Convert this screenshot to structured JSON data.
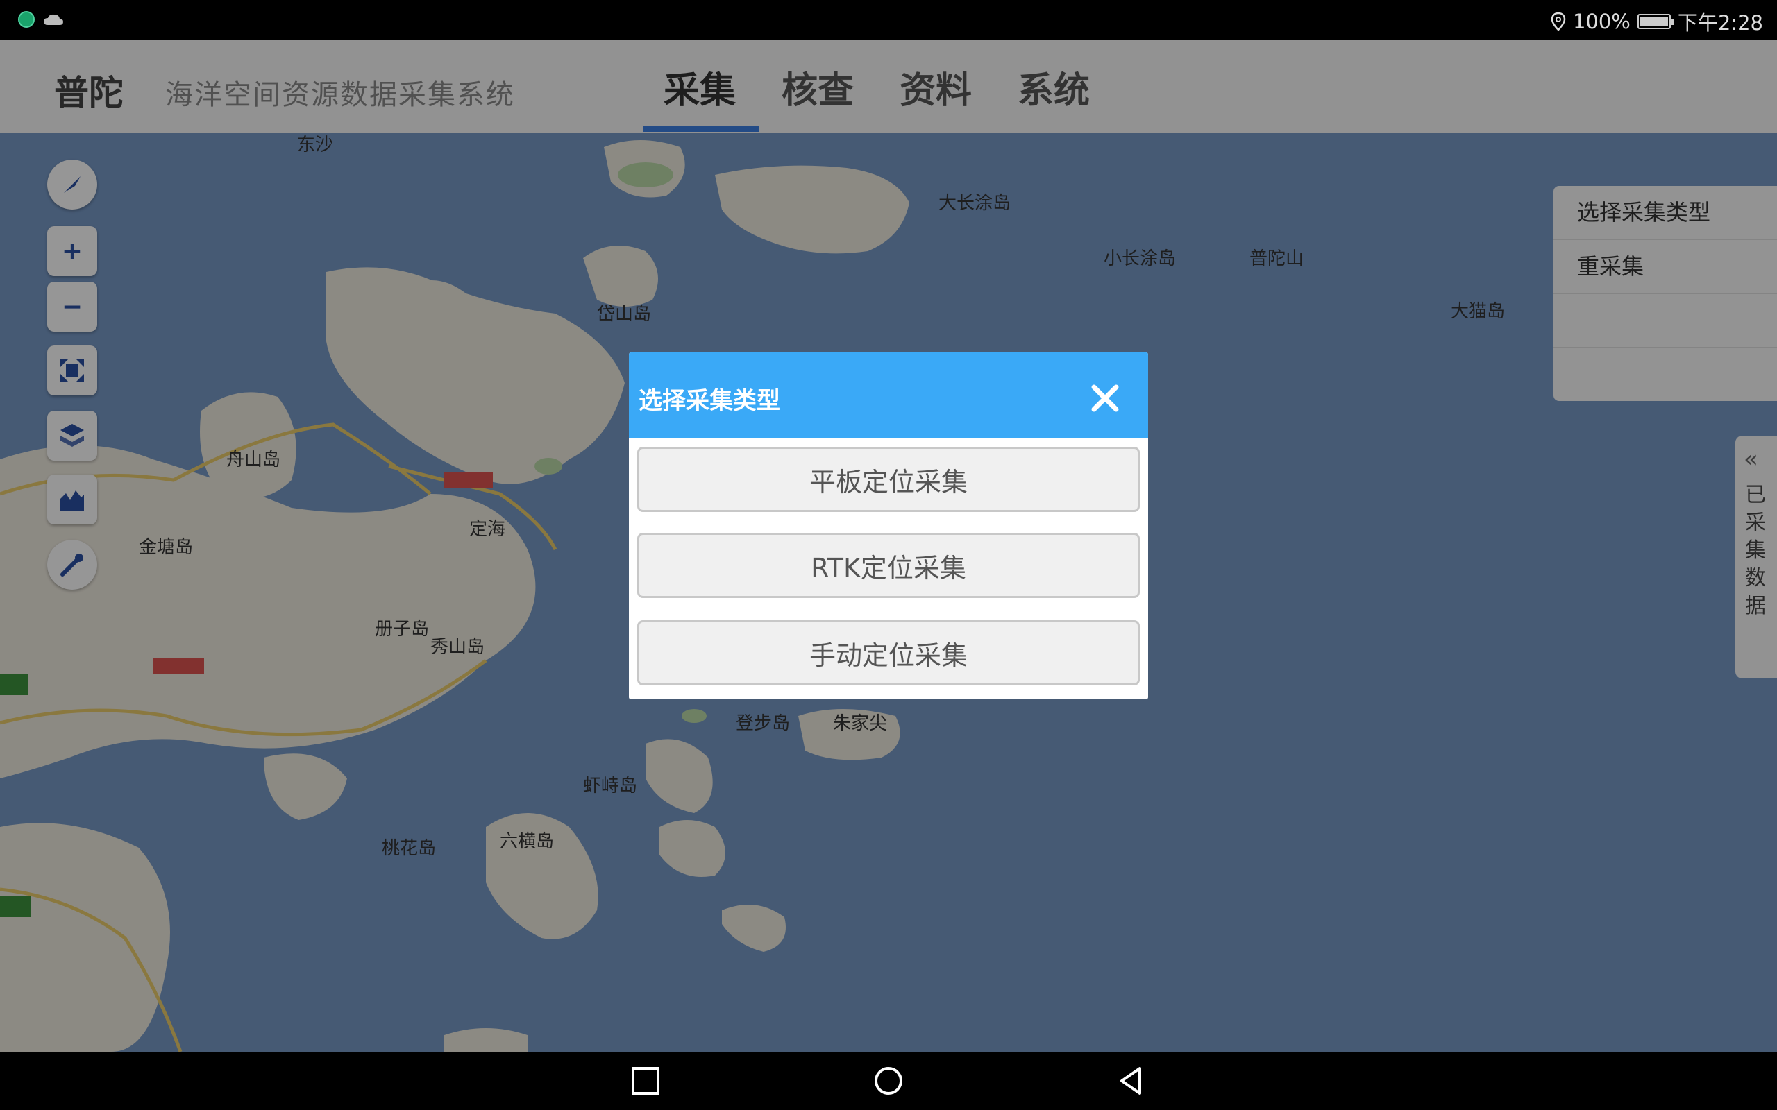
{
  "status_bar": {
    "battery_percent": "100%",
    "time": "下午2:28",
    "icons": [
      "app-icon",
      "cloud-icon",
      "location-icon",
      "battery-charging-icon"
    ],
    "battery_level": 1.0
  },
  "app": {
    "brand": "普陀",
    "system_name": "海洋空间资源数据采集系统",
    "nav_tabs": [
      {
        "label": "采集",
        "active": true
      },
      {
        "label": "核查",
        "active": false
      },
      {
        "label": "资料",
        "active": false
      },
      {
        "label": "系统",
        "active": false
      }
    ],
    "left_tools": [
      "compass-icon",
      "zoom-in-icon",
      "zoom-out-icon",
      "fullscreen-icon",
      "layers-icon",
      "chart-icon",
      "wrench-icon"
    ],
    "right_panel": {
      "items": [
        "选择采集类型",
        "重采集",
        "",
        ""
      ]
    },
    "right_tab": {
      "chevron": "«",
      "label": "已采集数据"
    },
    "map_labels": [
      "东沙",
      "大长涂岛",
      "小长涂岛",
      "岱山岛",
      "舟山岛",
      "定海",
      "六横岛",
      "虾峙岛",
      "桃花岛",
      "登步岛",
      "朱家尖",
      "普陀山",
      "大猫岛",
      "册子岛",
      "金塘岛",
      "秀山岛"
    ]
  },
  "dialog": {
    "title": "选择采集类型",
    "close_icon": "close-icon",
    "options": [
      "平板定位采集",
      "RTK定位采集",
      "手动定位采集"
    ],
    "header_color": "#3aa9f7"
  },
  "navigation_bar": {
    "icons": [
      "recent-apps-icon",
      "home-icon",
      "back-icon"
    ]
  }
}
